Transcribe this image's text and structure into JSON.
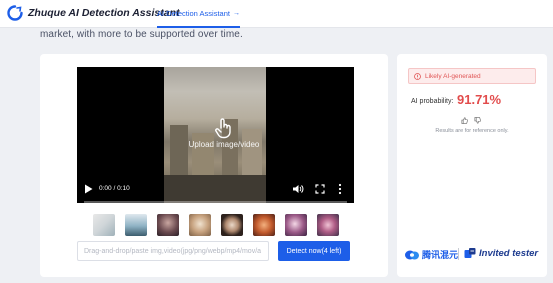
{
  "header": {
    "brand_name": "Zhuque AI Detection Assistant",
    "nav_tab_label": "AI Detection Assistant",
    "nav_tab_arrow": "→"
  },
  "intro_text": "market, with more to be supported over time.",
  "player": {
    "upload_label": "Upload image/video",
    "time_display": "0:00 / 0:10",
    "progress": 0
  },
  "thumbnails": [
    "thumb-1",
    "thumb-2",
    "thumb-3",
    "thumb-4",
    "thumb-5",
    "thumb-6",
    "thumb-7",
    "thumb-8"
  ],
  "input": {
    "placeholder": "Drag-and-drop/paste img,video(jpg/png/webp/mp4/mov/a"
  },
  "detect_button_label": "Detect now(4 left)",
  "result": {
    "verdict": "Likely AI-generated",
    "probability_label": "AI probability:",
    "probability_value": "91.71%",
    "reference_note": "Results are for reference only."
  },
  "footer": {
    "tencent_label": "腾讯混元",
    "invited_label": "Invited tester"
  },
  "colors": {
    "accent": "#1d5ee8",
    "danger": "#e24c4c",
    "background": "#eef0f4"
  },
  "icons": [
    "zhuque-logo-icon",
    "arrow-icon",
    "hand-pointer-icon",
    "play-icon",
    "volume-icon",
    "fullscreen-icon",
    "more-vertical-icon",
    "warning-icon",
    "thumbs-up-icon",
    "thumbs-down-icon",
    "tencent-hunyuan-icon",
    "invite-icon"
  ]
}
